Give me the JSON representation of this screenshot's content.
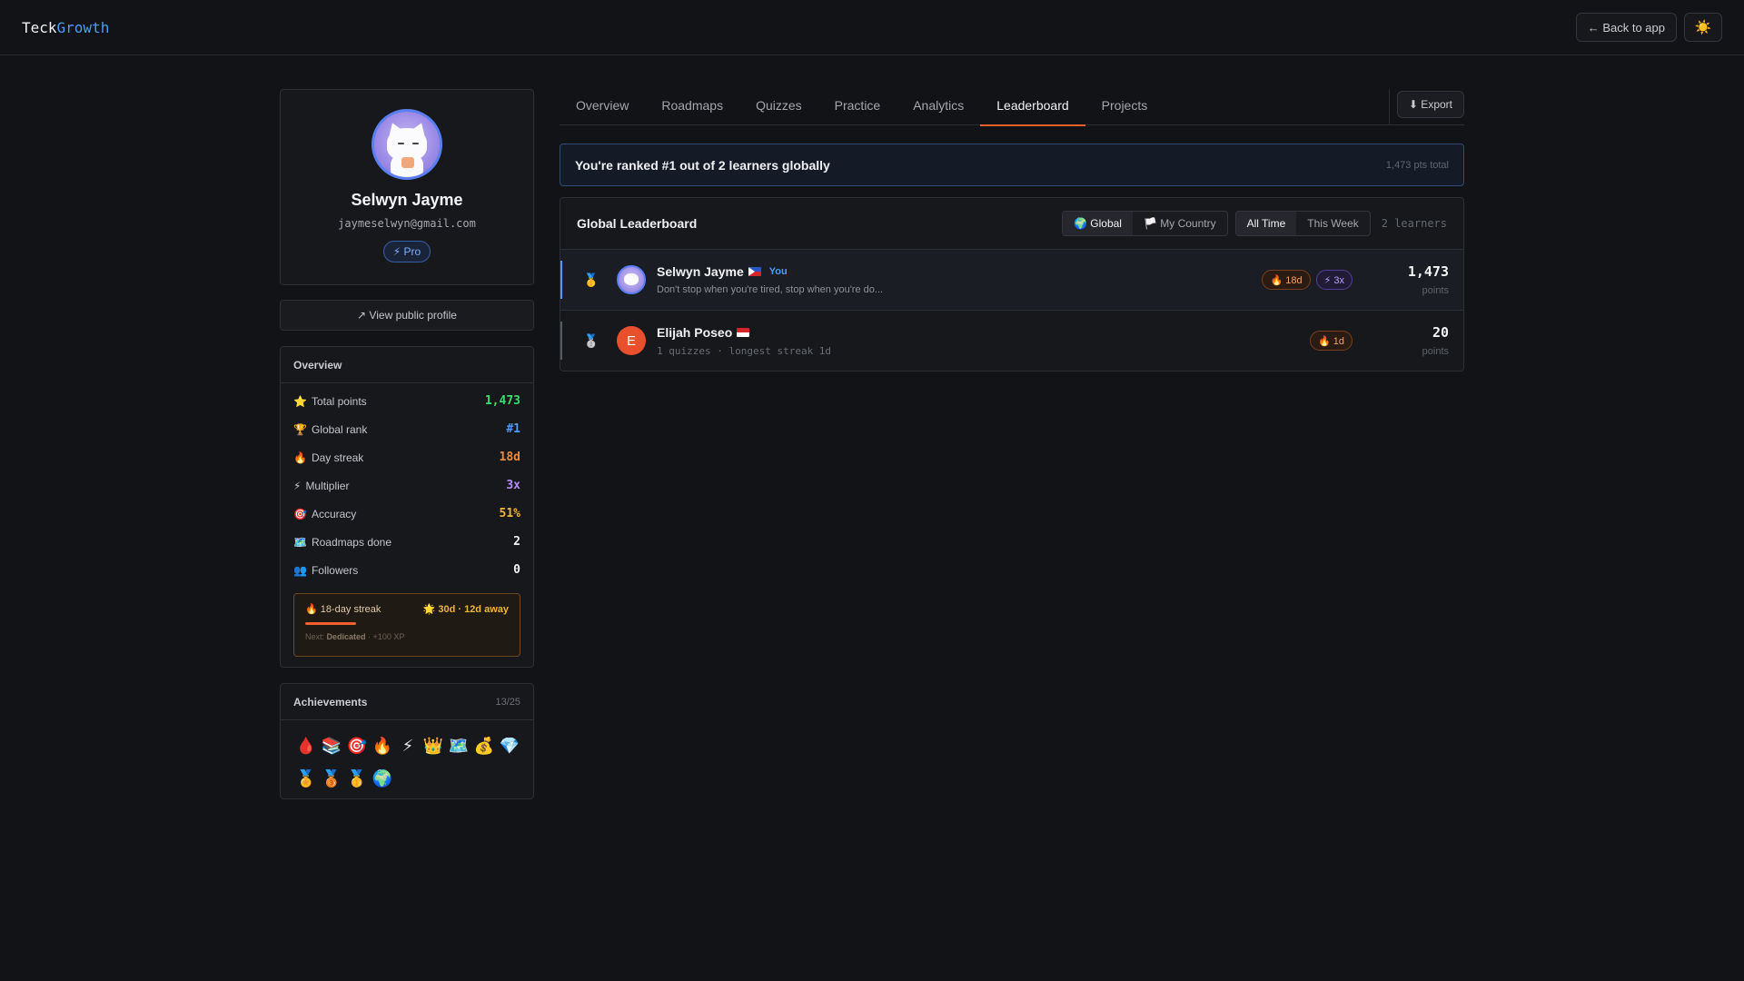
{
  "app": {
    "logo_part1": "Teck",
    "logo_part2": "Growth",
    "back_label": "← Back to app",
    "theme_icon": "☀️"
  },
  "profile": {
    "name": "Selwyn Jayme",
    "email": "jaymeselwyn@gmail.com",
    "badge": "⚡ Pro",
    "view_public": "↗ View public profile"
  },
  "overview": {
    "title": "Overview",
    "stats": [
      {
        "icon": "⭐",
        "label": "Total points",
        "value": "1,473",
        "color": "#3ddc6a"
      },
      {
        "icon": "🏆",
        "label": "Global rank",
        "value": "#1",
        "color": "#4c9cff"
      },
      {
        "icon": "🔥",
        "label": "Day streak",
        "value": "18d",
        "color": "#f08a3a"
      },
      {
        "icon": "⚡",
        "label": "Multiplier",
        "value": "3x",
        "color": "#b58cff"
      },
      {
        "icon": "🎯",
        "label": "Accuracy",
        "value": "51%",
        "color": "#f1b534"
      },
      {
        "icon": "🗺️",
        "label": "Roadmaps done",
        "value": "2",
        "color": "#f1f2f4"
      },
      {
        "icon": "👥",
        "label": "Followers",
        "value": "0",
        "color": "#f1f2f4"
      }
    ],
    "streak": {
      "left": "🔥 18-day streak",
      "right": "🌟 30d · 12d away",
      "next_prefix": "Next:",
      "next_name": "Dedicated",
      "next_suffix": "· +100 XP"
    }
  },
  "achievements": {
    "title": "Achievements",
    "count": "13/25",
    "icons": [
      "🩸",
      "📚",
      "🎯",
      "🔥",
      "⚡",
      "👑",
      "🗺️",
      "💰",
      "💎",
      "🏅",
      "🥉",
      "🥇",
      "🌍"
    ]
  },
  "tabs": [
    "Overview",
    "Roadmaps",
    "Quizzes",
    "Practice",
    "Analytics",
    "Leaderboard",
    "Projects"
  ],
  "active_tab": "Leaderboard",
  "export_label": "⬇ Export",
  "rank_banner": {
    "message": "You're ranked #1 out of 2 learners globally",
    "total": "1,473 pts total"
  },
  "leaderboard": {
    "title": "Global Leaderboard",
    "scope": [
      "🌍 Global",
      "🏳️ My Country"
    ],
    "period": [
      "All Time",
      "This Week"
    ],
    "count": "2 learners",
    "rows": [
      {
        "medal": "🥇",
        "name": "Selwyn Jayme",
        "you": "You",
        "sub": "Don't stop when you're tired, stop when you're do...",
        "streak": "🔥 18d",
        "multiplier": "⚡ 3x",
        "points": "1,473",
        "points_label": "points"
      },
      {
        "medal": "🥈",
        "initial": "E",
        "name": "Elijah Poseo",
        "sub": "1 quizzes · longest streak 1d",
        "streak": "🔥 1d",
        "points": "20",
        "points_label": "points"
      }
    ]
  }
}
